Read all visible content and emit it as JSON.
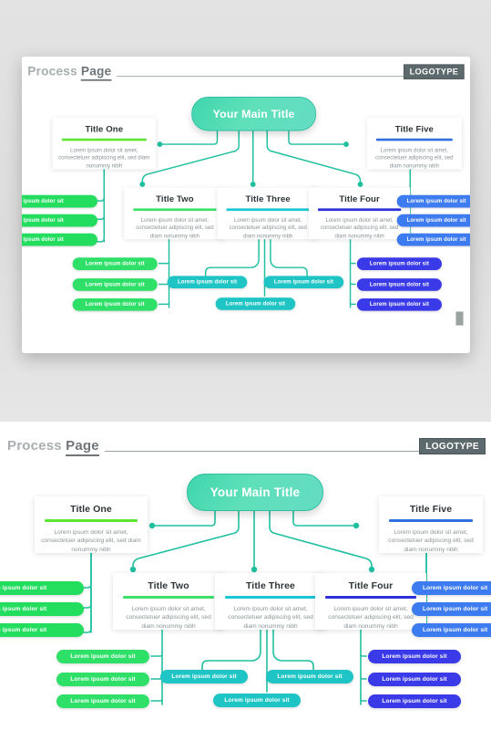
{
  "header": {
    "title_light": "Process ",
    "title_bold": "Page",
    "logotype": "LOGOTYPE"
  },
  "colors": {
    "teal": "#20bfa0",
    "green": "#3ee06a",
    "bright_green": "#5ce632",
    "cyan": "#19c6d4",
    "blue": "#2f6fe0",
    "indigo": "#3b3fe0",
    "main_gradient_from": "#3fd6ae",
    "main_gradient_to": "#64dcc4",
    "text_gray": "#8b9396",
    "heading_gray": "#2d3436"
  },
  "main_node": {
    "label": "Your Main Title"
  },
  "lorem": "Lorem ipsum dolor sit amet, consectetuer adipiscing elit, sed diam nonummy nibh",
  "nodes": [
    {
      "id": "title-one",
      "title": "Title One",
      "bar_color": "#5ce632",
      "description": "Lorem ipsum dolor sit amet, consectetuer adipiscing elit, sed diam nonummy nibh",
      "children": [
        {
          "label": "Lorem ipsum dolor sit",
          "color": "#22dd5e"
        },
        {
          "label": "Lorem ipsum dolor sit",
          "color": "#22dd5e"
        },
        {
          "label": "Lorem ipsum dolor sit",
          "color": "#22dd5e"
        }
      ]
    },
    {
      "id": "title-two",
      "title": "Title Two",
      "bar_color": "#3ee06a",
      "description": "Lorem ipsum dolor sit amet, consectetuer adipiscing elit, sed diam nonummy nibh",
      "children": [
        {
          "label": "Lorem ipsum dolor sit",
          "color": "#2ee067"
        },
        {
          "label": "Lorem ipsum dolor sit",
          "color": "#2ee067"
        },
        {
          "label": "Lorem ipsum dolor sit",
          "color": "#2ee067"
        }
      ]
    },
    {
      "id": "title-three",
      "title": "Title Three",
      "bar_color": "#19c6d4",
      "description": "Lorem ipsum dolor sit amet, consectetuer adipiscing elit, sed diam nonummy nibh",
      "children": [
        {
          "label": "Lorem ipsum dolor sit",
          "color": "#1fc5c5"
        },
        {
          "label": "Lorem ipsum dolor sit",
          "color": "#1fc5c5"
        },
        {
          "label": "Lorem ipsum dolor sit",
          "color": "#1fc5c5"
        }
      ]
    },
    {
      "id": "title-four",
      "title": "Title Four",
      "bar_color": "#2f2fd8",
      "description": "Lorem ipsum dolor sit amet, consectetuer adipiscing elit, sed diam nonummy nibh",
      "children": [
        {
          "label": "Lorem ipsum dolor sit",
          "color": "#3a3ae8"
        },
        {
          "label": "Lorem ipsum dolor sit",
          "color": "#3a3ae8"
        },
        {
          "label": "Lorem ipsum dolor sit",
          "color": "#3a3ae8"
        }
      ]
    },
    {
      "id": "title-five",
      "title": "Title Five",
      "bar_color": "#2f6fe0",
      "description": "Lorem ipsum dolor sit amet, consectetuer adipiscing elit, sed diam nonummy nibh",
      "children": [
        {
          "label": "Lorem ipsum dolor sit",
          "color": "#3d7bf0"
        },
        {
          "label": "Lorem ipsum dolor sit",
          "color": "#3d7bf0"
        },
        {
          "label": "Lorem ipsum dolor sit",
          "color": "#3d7bf0"
        }
      ]
    }
  ]
}
